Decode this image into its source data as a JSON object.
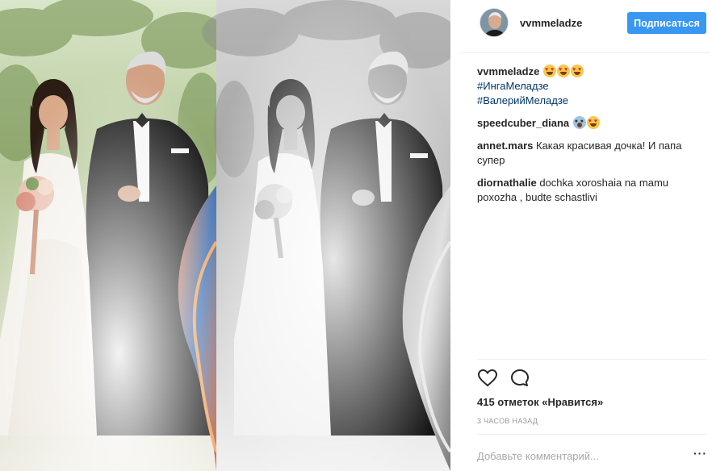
{
  "post": {
    "author": "vvmmeladze",
    "follow_label": "Подписаться",
    "caption": {
      "username": "vvmmeladze",
      "emojis": [
        "heart-eyes-emoji",
        "heart-eyes-emoji",
        "heart-eyes-emoji"
      ],
      "hashtags": [
        "#ИнгаМеладзе",
        "#ВалерийМеладзе"
      ]
    },
    "comments": [
      {
        "username": "speedcuber_diana",
        "text": "",
        "emojis": [
          "screaming-face-emoji",
          "heart-eyes-emoji"
        ]
      },
      {
        "username": "annet.mars",
        "text": "Какая красивая дочка! И папа супер"
      },
      {
        "username": "diornathalie",
        "text": "dochka xoroshaia na mamu poxozha , budte schastlivi"
      }
    ],
    "icons": {
      "like": "heart-outline-icon",
      "comment": "speech-bubble-icon",
      "more": "more-options-icon"
    },
    "likes": "415 отметок «Нравится»",
    "timestamp": "3 ЧАСОВ НАЗАД",
    "add_comment_placeholder": "Добавьте комментарий...",
    "more_label": "···"
  },
  "colors": {
    "accent": "#3897f0",
    "hashtag": "#003569",
    "text": "#262626",
    "muted": "#999999"
  }
}
